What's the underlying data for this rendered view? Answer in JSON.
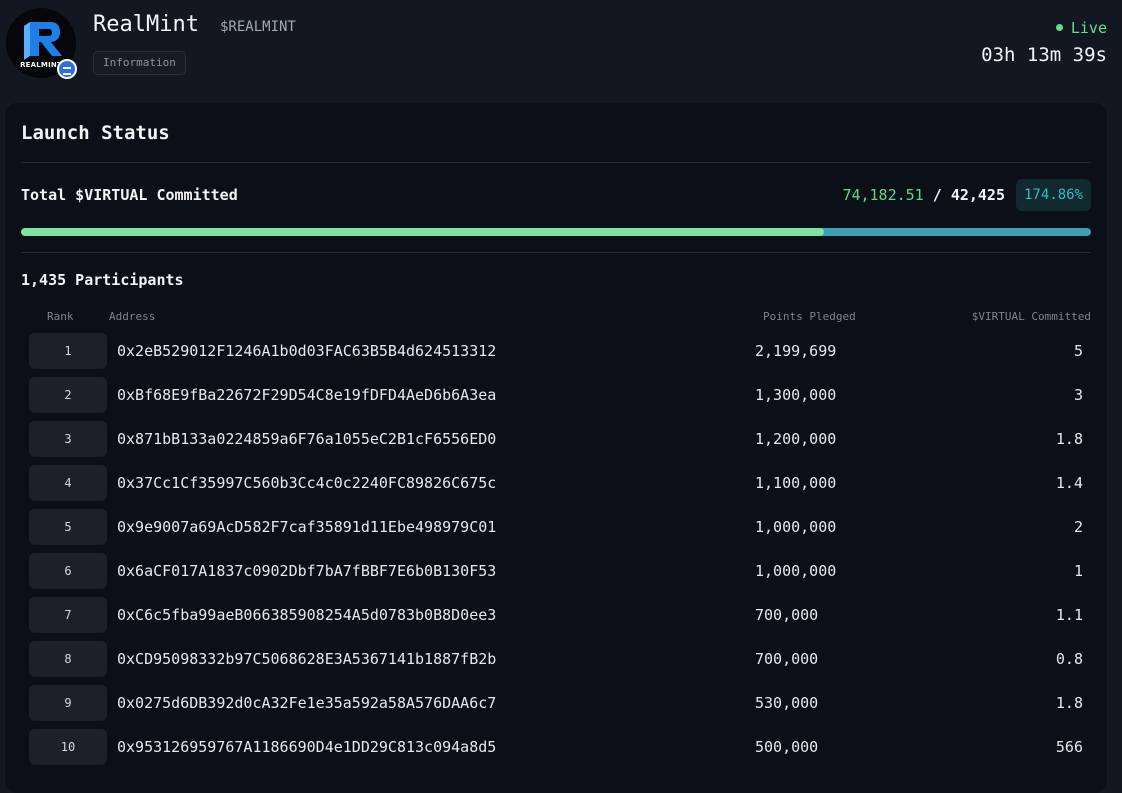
{
  "token": {
    "name": "RealMint",
    "ticker": "$REALMINT",
    "logo_text": "REALMINT",
    "info_tag": "Information"
  },
  "status": {
    "live_label": "Live",
    "countdown": "03h 13m 39s"
  },
  "launch": {
    "title": "Launch Status",
    "commit_label": "Total $VIRTUAL Committed",
    "committed": "74,182.51",
    "separator": "/",
    "target": "42,425",
    "percent": "174.86%",
    "progress_fraction": 0.75,
    "participants_label": "1,435 Participants"
  },
  "colors": {
    "live": "#5fe08a",
    "progress_committed": "#7de3a0",
    "progress_over": "#3aa0b4",
    "percent_badge": "#3fb5c5"
  },
  "table": {
    "headers": {
      "rank": "Rank",
      "address": "Address",
      "points": "Points Pledged",
      "committed": "$VIRTUAL Committed"
    },
    "rows": [
      {
        "rank": "1",
        "address": "0x2eB529012F1246A1b0d03FAC63B5B4d624513312",
        "points": "2,199,699",
        "committed": "5"
      },
      {
        "rank": "2",
        "address": "0xBf68E9fBa22672F29D54C8e19fDFD4AeD6b6A3ea",
        "points": "1,300,000",
        "committed": "3"
      },
      {
        "rank": "3",
        "address": "0x871bB133a0224859a6F76a1055eC2B1cF6556ED0",
        "points": "1,200,000",
        "committed": "1.8"
      },
      {
        "rank": "4",
        "address": "0x37Cc1Cf35997C560b3Cc4c0c2240FC89826C675c",
        "points": "1,100,000",
        "committed": "1.4"
      },
      {
        "rank": "5",
        "address": "0x9e9007a69AcD582F7caf35891d11Ebe498979C01",
        "points": "1,000,000",
        "committed": "2"
      },
      {
        "rank": "6",
        "address": "0x6aCF017A1837c0902Dbf7bA7fBBF7E6b0B130F53",
        "points": "1,000,000",
        "committed": "1"
      },
      {
        "rank": "7",
        "address": "0xC6c5fba99aeB066385908254A5d0783b0B8D0ee3",
        "points": "700,000",
        "committed": "1.1"
      },
      {
        "rank": "8",
        "address": "0xCD95098332b97C5068628E3A5367141b1887fB2b",
        "points": "700,000",
        "committed": "0.8"
      },
      {
        "rank": "9",
        "address": "0x0275d6DB392d0cA32Fe1e35a592a58A576DAA6c7",
        "points": "530,000",
        "committed": "1.8"
      },
      {
        "rank": "10",
        "address": "0x953126959767A1186690D4e1DD29C813c094a8d5",
        "points": "500,000",
        "committed": "566"
      }
    ]
  }
}
